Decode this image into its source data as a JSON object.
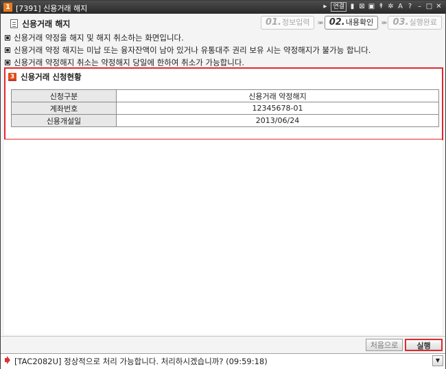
{
  "window": {
    "app_number": "1",
    "title": "[7391] 신용거래 해지",
    "controls": {
      "link_label": "연결"
    }
  },
  "header": {
    "page_title": "신용거래 해지"
  },
  "steps": [
    {
      "num": "01.",
      "label": "정보입력",
      "active": false
    },
    {
      "num": "02.",
      "label": "내용확인",
      "active": true
    },
    {
      "num": "03.",
      "label": "실행완료",
      "active": false
    }
  ],
  "notes": [
    "신용거래 약정을 해지 및 해지 취소하는 화면입니다.",
    "신용거래 약정 해지는 미납 또는 융자잔액이 남아 있거나 유통대주 권리 보유 시는 약정해지가 불가능 합니다.",
    "신용거래 약정해지 취소는 약정해지 당일에 한하여 취소가 가능합니다."
  ],
  "panel": {
    "badge": "3",
    "title": "신용거래 신청현황",
    "rows": [
      {
        "label": "신청구분",
        "value": "신용거래 약정해지"
      },
      {
        "label": "계좌번호",
        "value": "12345678-01"
      },
      {
        "label": "신용개설일",
        "value": "2013/06/24"
      }
    ]
  },
  "buttons": {
    "reset_label": "처음으로",
    "execute_label": "실행"
  },
  "status": {
    "message": "[TAC2082U] 정상적으로 처리 가능합니다. 처리하시겠습니까? (09:59:18)"
  },
  "colors": {
    "highlight": "#e0282b",
    "app_icon": "#e8791c"
  }
}
